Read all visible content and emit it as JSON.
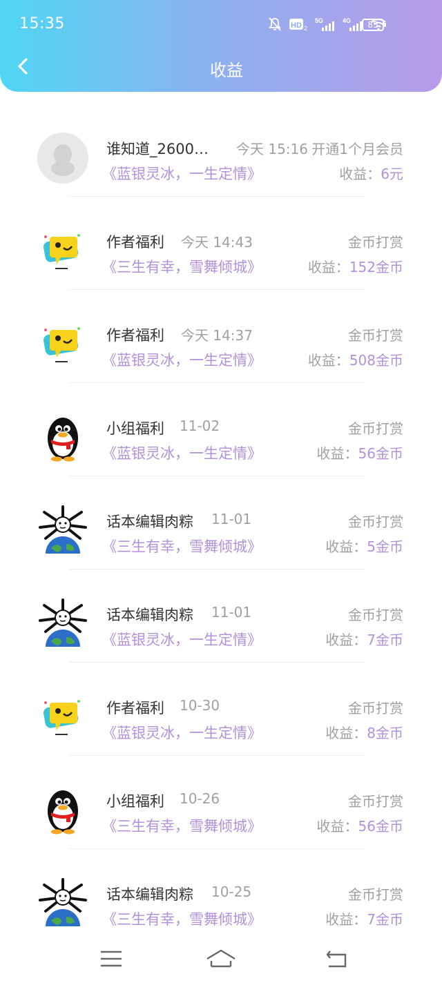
{
  "status_bar": {
    "time": "15:35",
    "battery": "85",
    "icons": [
      "mute-bell-icon",
      "hd-icon",
      "5g-signal-icon",
      "4g-signal-icon",
      "wifi-icon"
    ]
  },
  "header": {
    "title": "收益",
    "back_icon": "chevron-left-icon"
  },
  "records": [
    {
      "avatar": "default-avatar",
      "name": "谁知道_2600…",
      "time": "今天 15:16",
      "type": "开通1个月会员",
      "book": "《蓝银灵冰，一生定情》",
      "earn_label": "收益：",
      "earn_value": "6元"
    },
    {
      "avatar": "yellow-chat-avatar",
      "name": "作者福利",
      "time": "今天 14:43",
      "type": "金币打赏",
      "book": "《三生有幸，雪舞倾城》",
      "earn_label": "收益：",
      "earn_value": "152金币"
    },
    {
      "avatar": "yellow-chat-avatar",
      "name": "作者福利",
      "time": "今天 14:37",
      "type": "金币打赏",
      "book": "《蓝银灵冰，一生定情》",
      "earn_label": "收益：",
      "earn_value": "508金币"
    },
    {
      "avatar": "penguin-avatar",
      "name": "小组福利",
      "time": "11-02",
      "type": "金币打赏",
      "book": "《蓝银灵冰，一生定情》",
      "earn_label": "收益：",
      "earn_value": "56金币"
    },
    {
      "avatar": "earth-avatar",
      "name": "话本编辑肉粽",
      "time": "11-01",
      "type": "金币打赏",
      "book": "《三生有幸，雪舞倾城》",
      "earn_label": "收益：",
      "earn_value": "5金币"
    },
    {
      "avatar": "earth-avatar",
      "name": "话本编辑肉粽",
      "time": "11-01",
      "type": "金币打赏",
      "book": "《蓝银灵冰，一生定情》",
      "earn_label": "收益：",
      "earn_value": "7金币"
    },
    {
      "avatar": "yellow-chat-avatar",
      "name": "作者福利",
      "time": "10-30",
      "type": "金币打赏",
      "book": "《蓝银灵冰，一生定情》",
      "earn_label": "收益：",
      "earn_value": "8金币"
    },
    {
      "avatar": "penguin-avatar",
      "name": "小组福利",
      "time": "10-26",
      "type": "金币打赏",
      "book": "《三生有幸，雪舞倾城》",
      "earn_label": "收益：",
      "earn_value": "56金币"
    },
    {
      "avatar": "earth-avatar",
      "name": "话本编辑肉粽",
      "time": "10-25",
      "type": "金币打赏",
      "book": "《三生有幸，雪舞倾城》",
      "earn_label": "收益：",
      "earn_value": "7金币"
    }
  ],
  "navbar": {
    "icons": [
      "menu-icon",
      "home-icon",
      "back-icon"
    ]
  },
  "colors": {
    "header_gradient_start": "#4fd6f4",
    "header_gradient_end": "#b89be9",
    "accent_purple": "#b391d9",
    "muted_gray": "#a0a0a0"
  }
}
